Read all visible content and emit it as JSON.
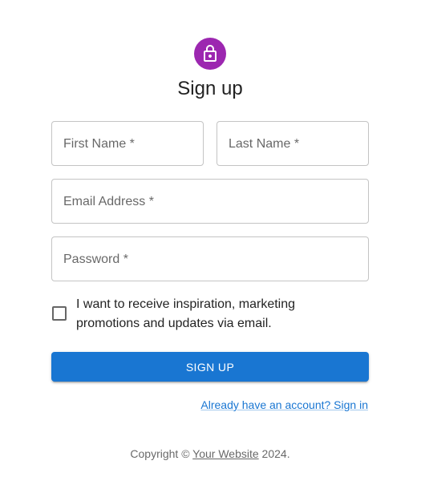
{
  "header": {
    "icon": "lock-outline-icon",
    "title": "Sign up"
  },
  "form": {
    "first_name_label": "First Name *",
    "last_name_label": "Last Name *",
    "email_label": "Email Address *",
    "password_label": "Password *",
    "marketing_checkbox_checked": false,
    "marketing_label": "I want to receive inspiration, marketing promotions and updates via email.",
    "submit_label": "SIGN UP",
    "signin_link": "Already have an account? Sign in"
  },
  "footer": {
    "copyright_prefix": "Copyright ©",
    "website_link": "Your Website",
    "year_suffix": "2024."
  },
  "colors": {
    "avatar": "#9c27b0",
    "primary": "#1976d2"
  }
}
